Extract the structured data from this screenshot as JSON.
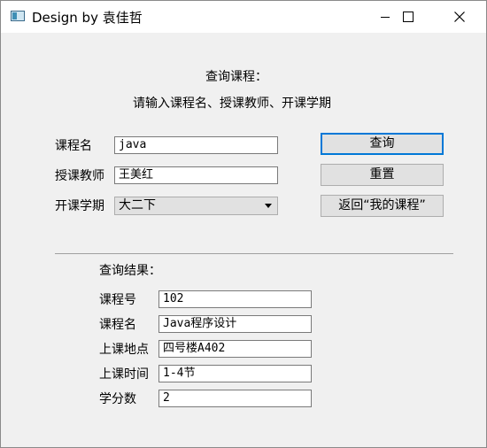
{
  "window": {
    "title": "Design by 袁佳哲",
    "controls": [
      "minimize-icon",
      "maximize-icon",
      "close-icon"
    ]
  },
  "header": {
    "heading": "查询课程：",
    "instruction": "请输入课程名、授课教师、开课学期"
  },
  "search": {
    "course_name": {
      "label": "课程名",
      "value": "java"
    },
    "teacher": {
      "label": "授课教师",
      "value": "王美红"
    },
    "semester": {
      "label": "开课学期",
      "value": "大二下"
    }
  },
  "buttons": {
    "query": "查询",
    "reset": "重置",
    "back": "返回“我的课程”"
  },
  "results": {
    "heading": "查询结果：",
    "fields": [
      {
        "label": "课程号",
        "value": "102"
      },
      {
        "label": "课程名",
        "value": "Java程序设计"
      },
      {
        "label": "上课地点",
        "value": "四号楼A402"
      },
      {
        "label": "上课时间",
        "value": "1-4节"
      },
      {
        "label": "学分数",
        "value": "2"
      }
    ]
  }
}
